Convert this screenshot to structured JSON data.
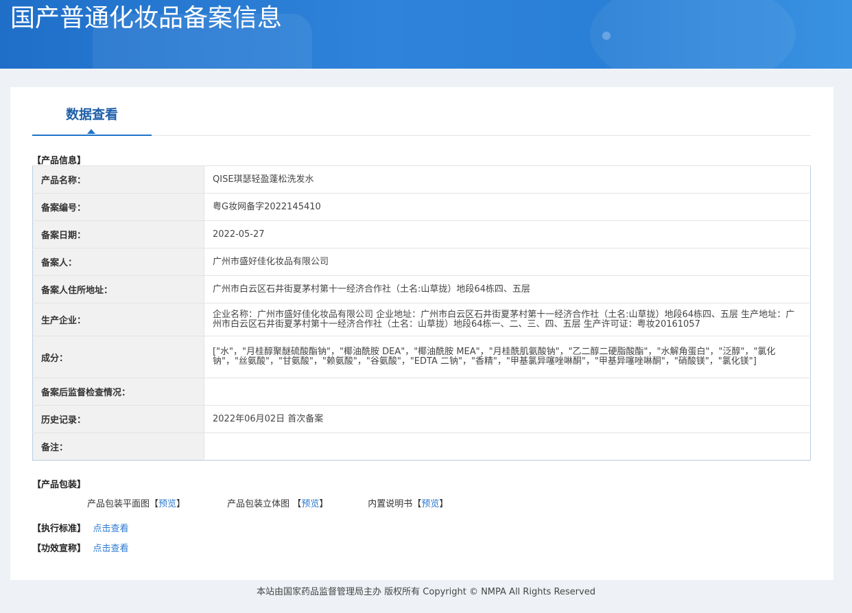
{
  "header": {
    "title": "国产普通化妆品备案信息"
  },
  "tab": {
    "label": "数据查看"
  },
  "sections": {
    "product_info": "【产品信息】",
    "packaging": "【产品包装】",
    "standard": "【执行标准】",
    "efficacy": "【功效宣称】"
  },
  "rows": [
    {
      "label": "产品名称：",
      "value": "QISE琪瑟轻盈蓬松洗发水"
    },
    {
      "label": "备案编号：",
      "value": "粤G妆网备字2022145410"
    },
    {
      "label": "备案日期：",
      "value": "2022-05-27"
    },
    {
      "label": "备案人：",
      "value": "广州市盛好佳化妆品有限公司"
    },
    {
      "label": "备案人住所地址：",
      "value": "广州市白云区石井街夏茅村第十一经济合作社（土名:山草拢）地段64栋四、五层"
    },
    {
      "label": "生产企业：",
      "value": "企业名称：广州市盛好佳化妆品有限公司 企业地址：广州市白云区石井街夏茅村第十一经济合作社（土名:山草拢）地段64栋四、五层 生产地址：广州市白云区石井街夏茅村第十一经济合作社（土名：山草拢）地段64栋一、二、三、四、五层 生产许可证：粤妆20161057"
    },
    {
      "label": "成分：",
      "value": "[\"水\"，\"月桂醇聚醚硫酸酯钠\"，\"椰油酰胺 DEA\"，\"椰油酰胺 MEA\"，\"月桂酰肌氨酸钠\"，\"乙二醇二硬脂酸酯\"，\"水解角蛋白\"，\"泛醇\"，\"氯化钠\"，\"丝氨酸\"，\"甘氨酸\"，\"赖氨酸\"，\"谷氨酸\"，\"EDTA 二钠\"，\"香精\"，\"甲基氯异噻唑啉酮\"，\"甲基异噻唑啉酮\"，\"硝酸镁\"，\"氯化镁\"]"
    },
    {
      "label": "备案后监督检查情况：",
      "value": ""
    },
    {
      "label": "历史记录：",
      "value": "2022年06月02日 首次备案"
    },
    {
      "label": "备注：",
      "value": ""
    }
  ],
  "packaging": {
    "flat_label": "产品包装平面图",
    "solid_label": "产品包装立体图",
    "manual_label": "内置说明书",
    "preview": "预览",
    "bracket_open": "【",
    "bracket_close": "】"
  },
  "links": {
    "view": "点击查看"
  },
  "footer": {
    "text": "本站由国家药品监督管理局主办 版权所有 Copyright © NMPA All Rights Reserved"
  }
}
